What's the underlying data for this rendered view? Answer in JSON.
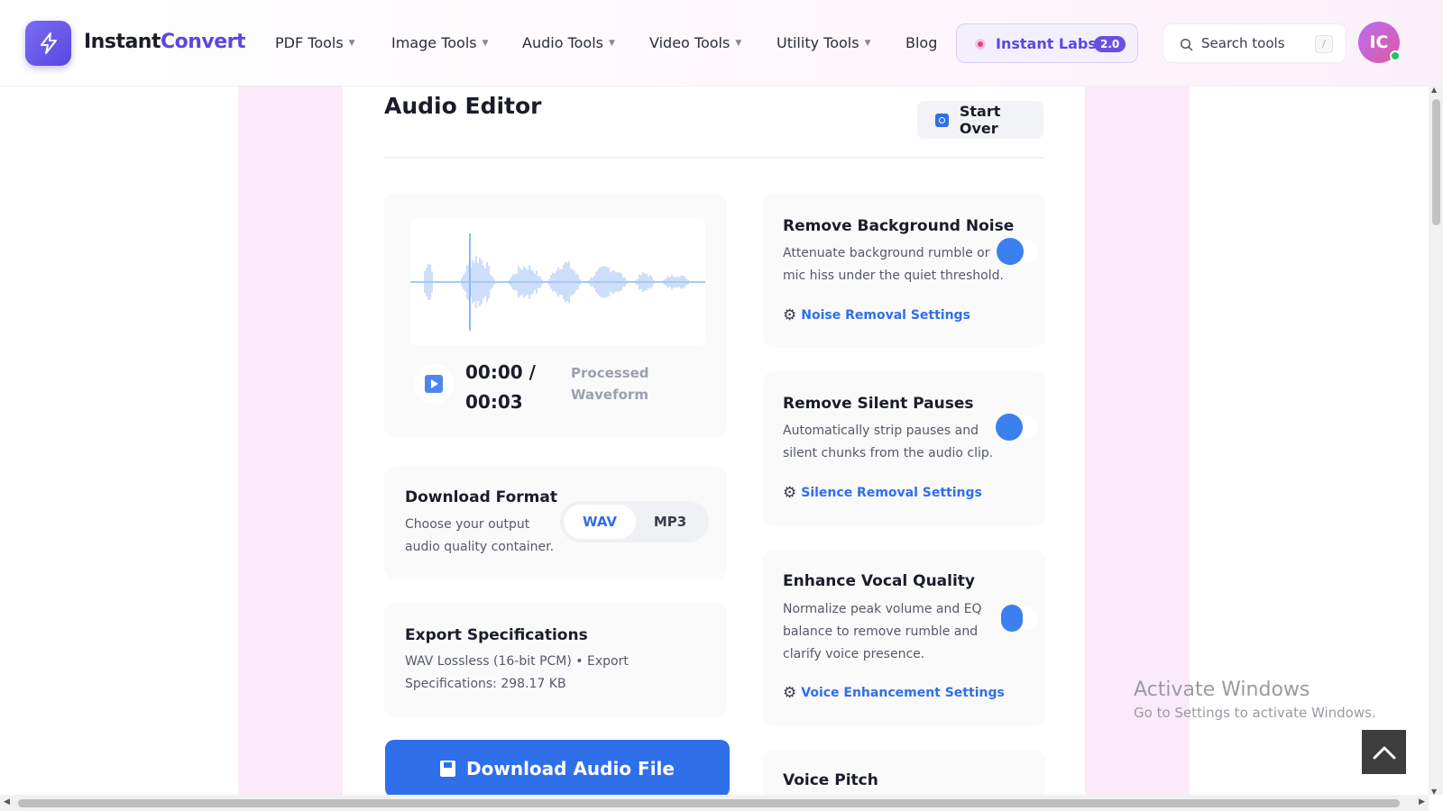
{
  "app": {
    "brand_part1": "Instant",
    "brand_part2": "Convert",
    "logo_icon": "lightning-bolt-icon",
    "accent_color": "#5b47e0"
  },
  "nav": {
    "items": [
      {
        "label": "PDF Tools",
        "has_dropdown": true
      },
      {
        "label": "Image Tools",
        "has_dropdown": true
      },
      {
        "label": "Audio Tools",
        "has_dropdown": true
      },
      {
        "label": "Video Tools",
        "has_dropdown": true
      },
      {
        "label": "Utility Tools",
        "has_dropdown": true
      },
      {
        "label": "Blog",
        "has_dropdown": false
      }
    ],
    "labs_label": "Instant Labs",
    "labs_badge": "2.0",
    "search_placeholder": "Search tools",
    "search_shortcut": "/",
    "avatar_initials": "IC"
  },
  "editor": {
    "title": "Audio Editor",
    "start_over_label": "Start Over",
    "player": {
      "time_current": "00:00 /",
      "time_total": "00:03",
      "waveform_label_line1": "Processed",
      "waveform_label_line2": "Waveform",
      "waveform_color": "#a9c8f5"
    },
    "download_format": {
      "title": "Download Format",
      "desc_line1": "Choose your output",
      "desc_line2": "audio quality container.",
      "options": [
        "WAV",
        "MP3"
      ],
      "selected": "WAV"
    },
    "export_specs": {
      "title": "Export Specifications",
      "line1": "WAV Lossless (16-bit PCM) • Export",
      "line2": "Specifications: 298.17 KB"
    },
    "download_label": "Download Audio File",
    "options": [
      {
        "title": "Remove Background Noise",
        "desc_line1": "Attenuate background rumble or",
        "desc_line2": "mic hiss under the quiet threshold.",
        "desc_line3": "",
        "link": "Noise Removal Settings",
        "enabled": true
      },
      {
        "title": "Remove Silent Pauses",
        "desc_line1": "Automatically strip pauses and",
        "desc_line2": "silent chunks from the audio clip.",
        "desc_line3": "",
        "link": "Silence Removal Settings",
        "enabled": true
      },
      {
        "title": "Enhance Vocal Quality",
        "desc_line1": "Normalize peak volume and EQ",
        "desc_line2": "balance to remove rumble and",
        "desc_line3": "clarify voice presence.",
        "link": "Voice Enhancement Settings",
        "enabled": true
      },
      {
        "title": "Voice Pitch"
      }
    ]
  },
  "watermark": {
    "line1": "Activate Windows",
    "line2": "Go to Settings to activate Windows."
  }
}
